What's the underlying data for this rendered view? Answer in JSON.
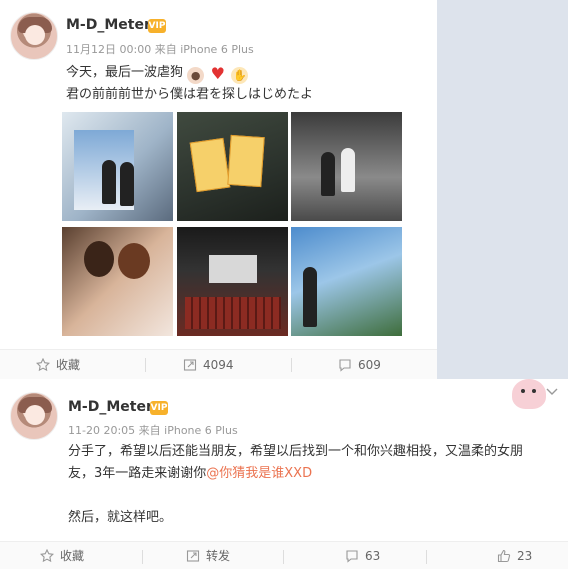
{
  "post1": {
    "username": "M-D_Meter",
    "vip_badge": "VIP",
    "time": "11月12日 00:00",
    "source": "来自 iPhone 6 Plus",
    "line1": "今天，最后一波虐狗",
    "line2": "君の前前前世から僕は君を探しはじめたよ",
    "actions": {
      "favorite": "收藏",
      "repost_count": "4094",
      "comment_count": "609"
    }
  },
  "post2": {
    "username": "M-D_Meter",
    "vip_badge": "VIP",
    "time": "11-20 20:05",
    "source": "来自 iPhone 6 Plus",
    "line1": "分手了，希望以后还能当朋友，希望以后找到一个和你兴趣相投，又温柔的女朋",
    "line2_prefix": "友，3年一路走来谢谢你",
    "mention": "@你猜我是谁XXD",
    "line3": "然后，就这样吧。",
    "actions": {
      "favorite": "收藏",
      "repost": "转发",
      "comment_count": "63",
      "like_count": "23"
    }
  },
  "icons": {
    "star": "star-icon",
    "repost": "repost-icon",
    "comment": "comment-icon",
    "like": "thumbs-up-icon",
    "chevron": "chevron-down-icon",
    "emoji_dog": "dog-emoji-icon",
    "emoji_heart": "heart-emoji-icon",
    "emoji_clap": "clap-emoji-icon"
  },
  "colors": {
    "link": "#eb7350",
    "vip": "#f7b12b",
    "background": "#dde3ec"
  }
}
